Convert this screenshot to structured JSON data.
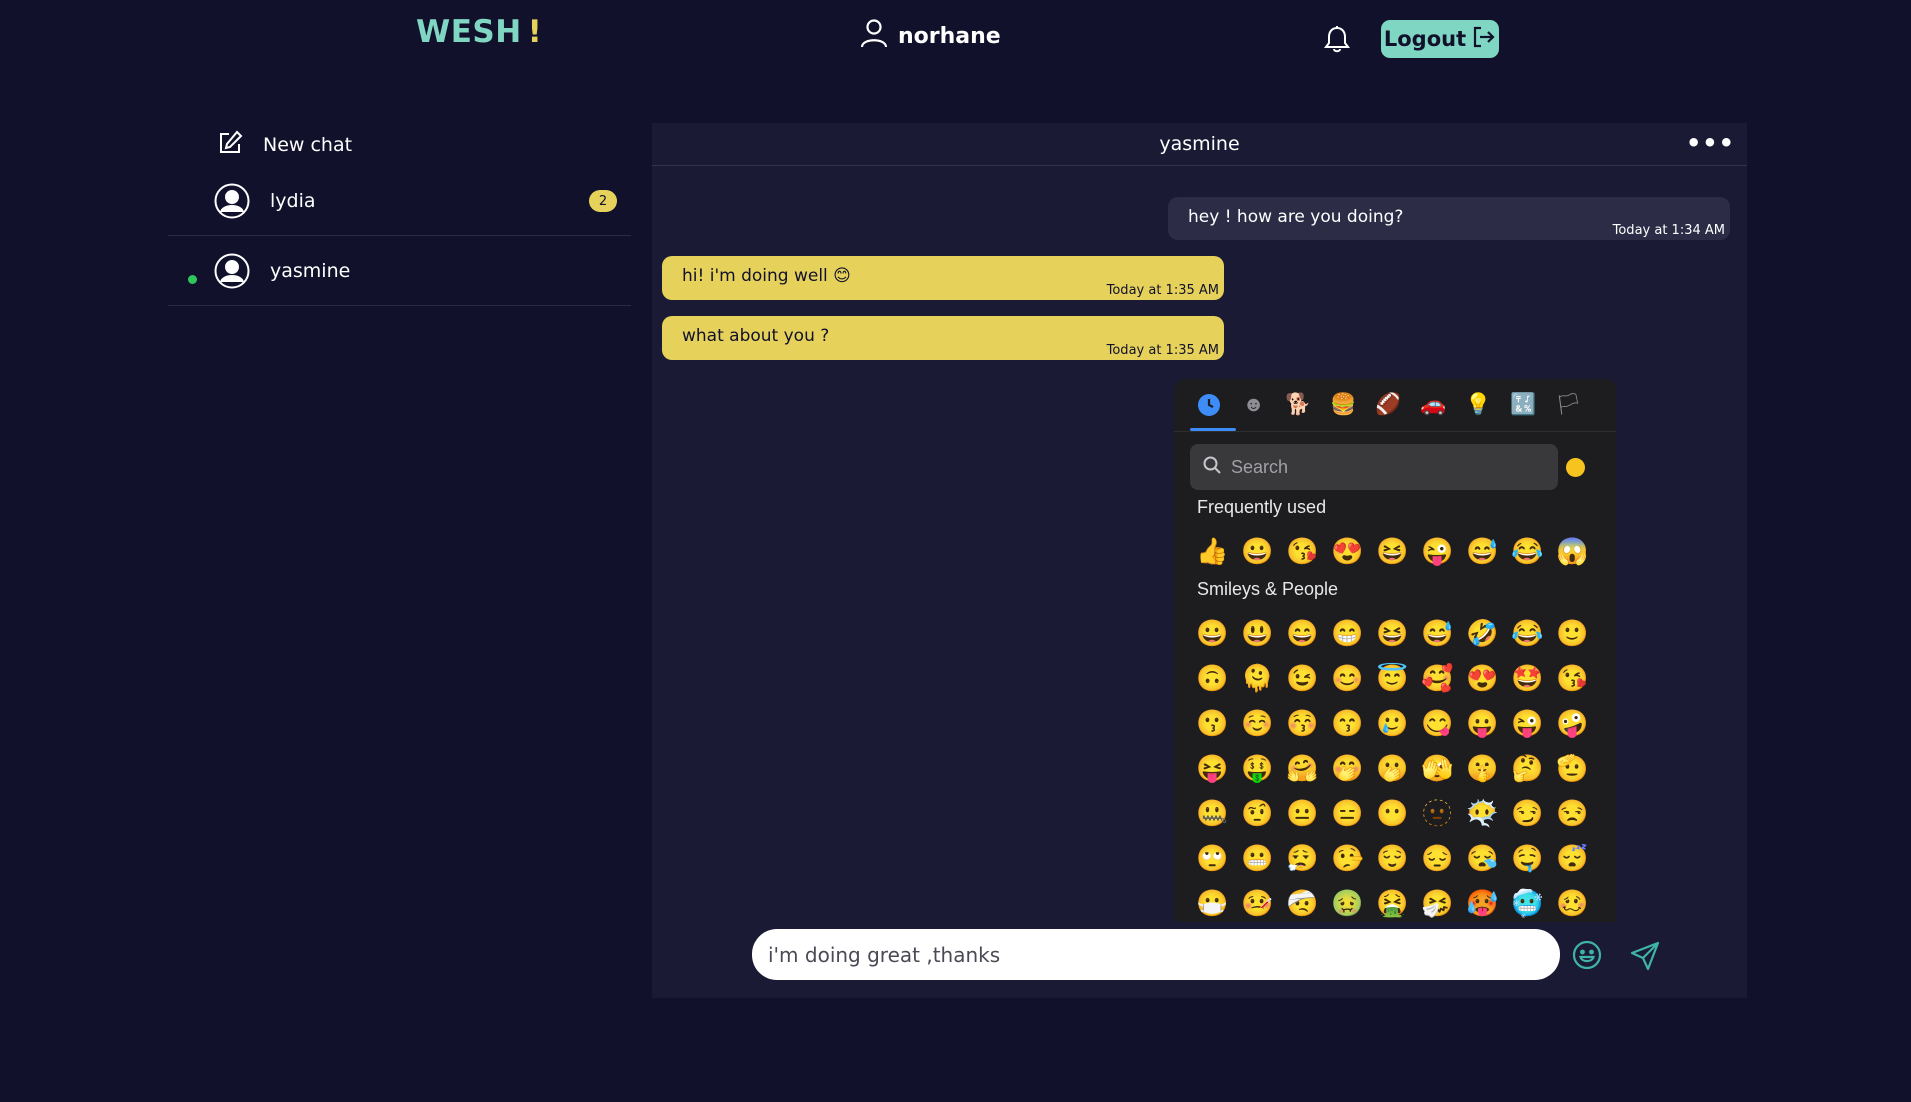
{
  "header": {
    "brand_word": "WESH",
    "brand_mark": "!",
    "username": "norhane",
    "logout_label": "Logout",
    "icons": {
      "user": "user-icon",
      "notifications": "bell-icon",
      "logout": "logout-arrow-icon"
    }
  },
  "sidebar": {
    "new_chat_label": "New chat",
    "conversations": [
      {
        "name": "lydia",
        "unread": "2",
        "online": false
      },
      {
        "name": "yasmine",
        "unread": "",
        "online": true
      }
    ]
  },
  "chat": {
    "contact_name": "yasmine",
    "menu_label": "•••",
    "messages": [
      {
        "direction": "outgoing",
        "text": "hey ! how are you doing?",
        "time": "Today at 1:34 AM"
      },
      {
        "direction": "incoming",
        "text": "hi! i'm doing well 😊",
        "time": "Today at 1:35 AM"
      },
      {
        "direction": "incoming",
        "text": "what about you ?",
        "time": "Today at 1:35 AM"
      }
    ],
    "composer_value": "i'm doing great ,thanks"
  },
  "emoji_picker": {
    "categories": [
      "🕒",
      "☻",
      "🐕",
      "🍔",
      "🏈",
      "🚗",
      "💡",
      "🔣",
      "🏳"
    ],
    "search_placeholder": "Search",
    "frequently_used_title": "Frequently used",
    "frequently_used": [
      "👍",
      "😀",
      "😘",
      "😍",
      "😆",
      "😜",
      "😅",
      "😂",
      "😱"
    ],
    "smileys_title": "Smileys & People",
    "smileys": [
      "😀",
      "😃",
      "😄",
      "😁",
      "😆",
      "😅",
      "🤣",
      "😂",
      "🙂",
      "🙃",
      "🫠",
      "😉",
      "😊",
      "😇",
      "🥰",
      "😍",
      "🤩",
      "😘",
      "😗",
      "☺️",
      "😚",
      "😙",
      "🥲",
      "😋",
      "😛",
      "😜",
      "🤪",
      "😝",
      "🤑",
      "🤗",
      "🤭",
      "🫢",
      "🫣",
      "🤫",
      "🤔",
      "🫡",
      "🤐",
      "🤨",
      "😐",
      "😑",
      "😶",
      "🫥",
      "😶‍🌫️",
      "😏",
      "😒",
      "🙄",
      "😬",
      "😮‍💨",
      "🤥",
      "😌",
      "😔",
      "😪",
      "🤤",
      "😴",
      "😷",
      "🤒",
      "🤕",
      "🤢",
      "🤮",
      "🤧",
      "🥵",
      "🥶",
      "🥴"
    ],
    "colors": {
      "active": "#3d8cf7",
      "skin_tone": "#f7c31f"
    }
  },
  "colors": {
    "background": "#11112b",
    "accent": "#7fd6c2",
    "incoming_bubble": "#e6d25a",
    "outgoing_bubble": "#2c2c47",
    "online": "#2fc75d"
  }
}
